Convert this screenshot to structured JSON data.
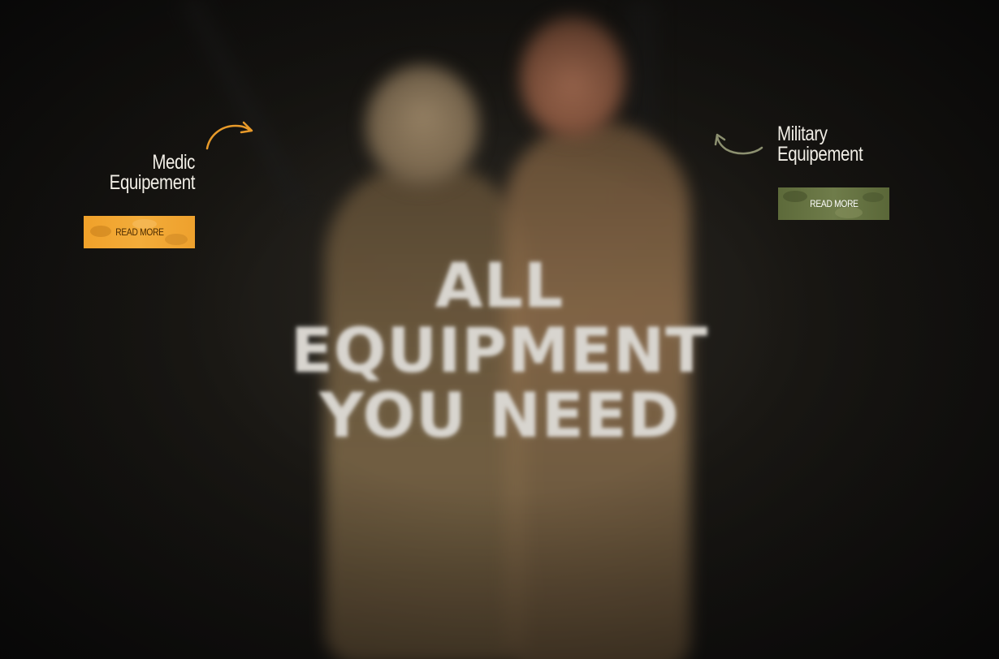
{
  "hero": {
    "headline_line1": "ALL EQUIPMENT",
    "headline_line2": "YOU NEED"
  },
  "medic": {
    "title_line1": "Medic",
    "title_line2": "Equipement",
    "button_label": "READ MORE",
    "arrow_icon": "curved-arrow-right-icon",
    "accent_color": "#f0a12a"
  },
  "military": {
    "title_line1": "Military",
    "title_line2": "Equipement",
    "button_label": "READ MORE",
    "arrow_icon": "curved-arrow-left-icon",
    "accent_color": "#6b7845"
  }
}
